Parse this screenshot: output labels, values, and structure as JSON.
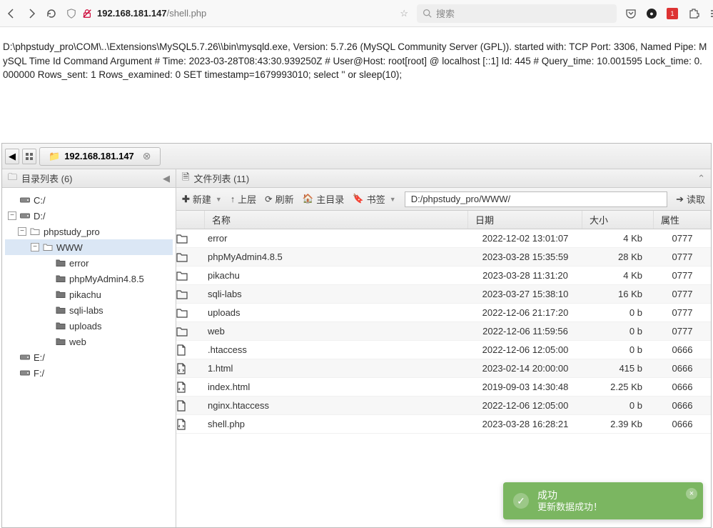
{
  "browser": {
    "url_host": "192.168.181.147",
    "url_path": "/shell.php",
    "search_placeholder": "搜索",
    "badge_count": "1"
  },
  "log": {
    "text": "D:\\phpstudy_pro\\COM\\..\\Extensions\\MySQL5.7.26\\\\bin\\mysqld.exe, Version: 5.7.26 (MySQL Community Server (GPL)). started with: TCP Port: 3306, Named Pipe: MySQL Time Id Command Argument # Time: 2023-03-28T08:43:30.939250Z # User@Host: root[root] @ localhost [::1] Id: 445 # Query_time: 10.001595 Lock_time: 0.000000 Rows_sent: 1 Rows_examined: 0 SET timestamp=1679993010; select '' or sleep(10);"
  },
  "tabs": {
    "main": "192.168.181.147"
  },
  "sidebar": {
    "title": "目录列表 (6)",
    "tree": [
      {
        "label": "C:/",
        "icon": "drive",
        "indent": 0,
        "exp": ""
      },
      {
        "label": "D:/",
        "icon": "drive",
        "indent": 0,
        "exp": "−"
      },
      {
        "label": "phpstudy_pro",
        "icon": "folder",
        "indent": 1,
        "exp": "−"
      },
      {
        "label": "WWW",
        "icon": "folder",
        "indent": 2,
        "exp": "−",
        "sel": true
      },
      {
        "label": "error",
        "icon": "folder-dark",
        "indent": 3,
        "exp": ""
      },
      {
        "label": "phpMyAdmin4.8.5",
        "icon": "folder-dark",
        "indent": 3,
        "exp": ""
      },
      {
        "label": "pikachu",
        "icon": "folder-dark",
        "indent": 3,
        "exp": ""
      },
      {
        "label": "sqli-labs",
        "icon": "folder-dark",
        "indent": 3,
        "exp": ""
      },
      {
        "label": "uploads",
        "icon": "folder-dark",
        "indent": 3,
        "exp": ""
      },
      {
        "label": "web",
        "icon": "folder-dark",
        "indent": 3,
        "exp": ""
      },
      {
        "label": "E:/",
        "icon": "drive",
        "indent": 0,
        "exp": ""
      },
      {
        "label": "F:/",
        "icon": "drive",
        "indent": 0,
        "exp": ""
      }
    ]
  },
  "filelist": {
    "title": "文件列表 (11)",
    "toolbar": {
      "new": "新建",
      "up": "上层",
      "refresh": "刷新",
      "home": "主目录",
      "bookmark": "书签",
      "path": "D:/phpstudy_pro/WWW/",
      "read": "读取"
    },
    "header": {
      "name": "名称",
      "date": "日期",
      "size": "大小",
      "perm": "属性"
    },
    "rows": [
      {
        "icon": "folder",
        "name": "error",
        "date": "2022-12-02 13:01:07",
        "size": "4 Kb",
        "perm": "0777"
      },
      {
        "icon": "folder",
        "name": "phpMyAdmin4.8.5",
        "date": "2023-03-28 15:35:59",
        "size": "28 Kb",
        "perm": "0777"
      },
      {
        "icon": "folder",
        "name": "pikachu",
        "date": "2023-03-28 11:31:20",
        "size": "4 Kb",
        "perm": "0777"
      },
      {
        "icon": "folder",
        "name": "sqli-labs",
        "date": "2023-03-27 15:38:10",
        "size": "16 Kb",
        "perm": "0777"
      },
      {
        "icon": "folder",
        "name": "uploads",
        "date": "2022-12-06 21:17:20",
        "size": "0 b",
        "perm": "0777"
      },
      {
        "icon": "folder",
        "name": "web",
        "date": "2022-12-06 11:59:56",
        "size": "0 b",
        "perm": "0777"
      },
      {
        "icon": "file",
        "name": ".htaccess",
        "date": "2022-12-06 12:05:00",
        "size": "0 b",
        "perm": "0666"
      },
      {
        "icon": "code",
        "name": "1.html",
        "date": "2023-02-14 20:00:00",
        "size": "415 b",
        "perm": "0666"
      },
      {
        "icon": "code",
        "name": "index.html",
        "date": "2019-09-03 14:30:48",
        "size": "2.25 Kb",
        "perm": "0666"
      },
      {
        "icon": "file",
        "name": "nginx.htaccess",
        "date": "2022-12-06 12:05:00",
        "size": "0 b",
        "perm": "0666"
      },
      {
        "icon": "code",
        "name": "shell.php",
        "date": "2023-03-28 16:28:21",
        "size": "2.39 Kb",
        "perm": "0666"
      }
    ]
  },
  "toast": {
    "title": "成功",
    "msg": "更新数据成功！"
  }
}
